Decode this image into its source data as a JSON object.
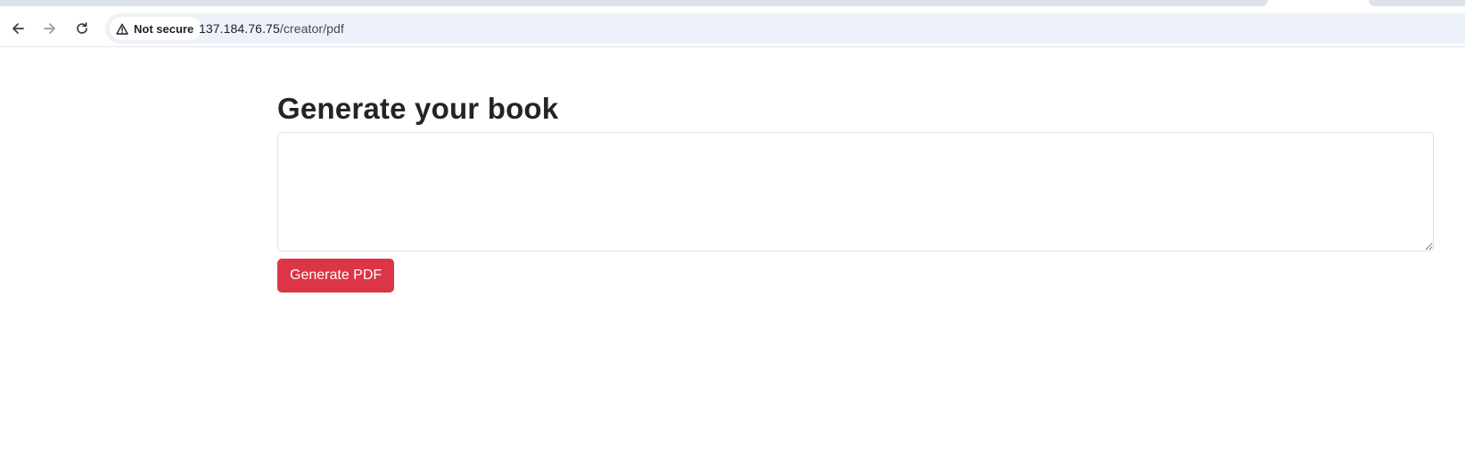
{
  "browser": {
    "security_label": "Not secure",
    "url_host": "137.184.76.75",
    "url_path": "/creator/pdf",
    "icons": {
      "back": "arrow-left-icon",
      "forward": "arrow-right-icon",
      "reload": "reload-icon",
      "security": "warning-triangle-icon"
    }
  },
  "page": {
    "title": "Generate your book",
    "textarea_value": "",
    "generate_button_label": "Generate PDF",
    "accent_color": "#dc3545"
  }
}
